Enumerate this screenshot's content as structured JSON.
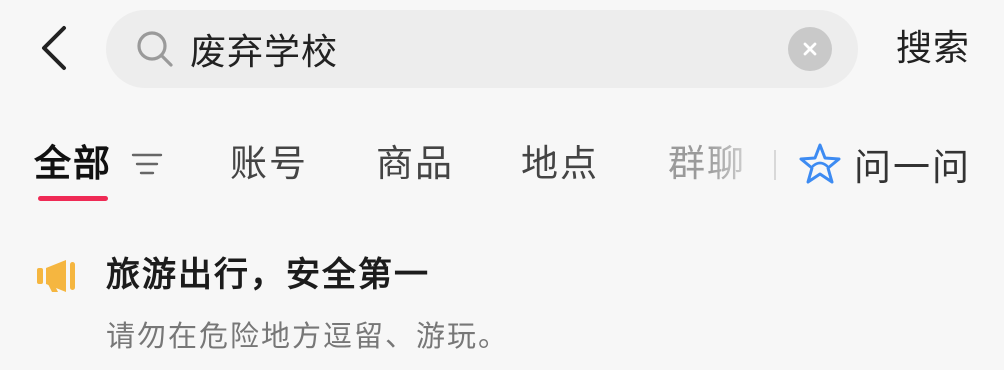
{
  "header": {
    "back_icon": "chevron-left-icon",
    "search": {
      "value": "废弃学校",
      "placeholder": "",
      "search_icon": "search-icon",
      "clear_icon": "clear-icon"
    },
    "search_action_label": "搜索"
  },
  "tabs": {
    "items": [
      {
        "label": "全部",
        "active": true
      },
      {
        "label": "账号",
        "active": false
      },
      {
        "label": "商品",
        "active": false
      },
      {
        "label": "地点",
        "active": false
      },
      {
        "label": "群聊",
        "active": false
      }
    ],
    "filter_icon": "filter-icon",
    "ask": {
      "label": "问一问",
      "icon": "sparkle-star-icon"
    }
  },
  "notice": {
    "icon": "megaphone-icon",
    "title": "旅游出行，安全第一",
    "body": "请勿在危险地方逗留、游玩。"
  },
  "colors": {
    "background": "#f7f7f7",
    "search_box": "#ededed",
    "active_underline": "#ef2a55",
    "notice_icon": "#f5b640",
    "ask_icon": "#3d8bf2"
  }
}
